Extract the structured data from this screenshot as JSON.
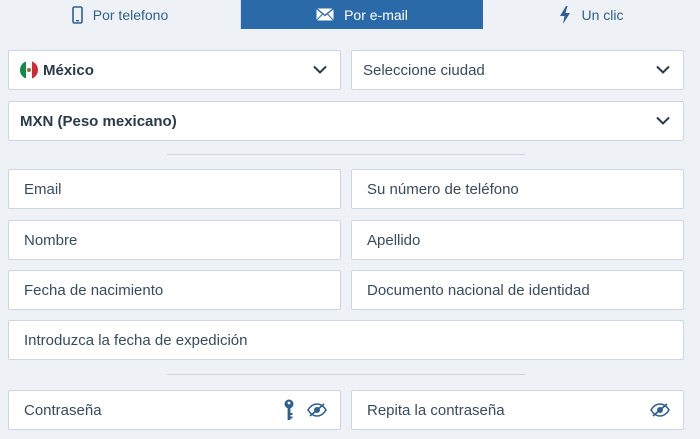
{
  "tabs": [
    {
      "label": "Por telefono",
      "icon": "phone-icon"
    },
    {
      "label": "Por e-mail",
      "icon": "envelope-icon",
      "active": true
    },
    {
      "label": "Un clic",
      "icon": "lightning-icon"
    }
  ],
  "country": {
    "value": "México",
    "icon": "mexico-flag-icon"
  },
  "city": {
    "placeholder": "Seleccione ciudad"
  },
  "currency": {
    "value": "MXN (Peso mexicano)"
  },
  "fields": {
    "email": "Email",
    "phone": "Su número de teléfono",
    "first_name": "Nombre",
    "last_name": "Apellido",
    "birth_date": "Fecha de nacimiento",
    "national_id": "Documento nacional de identidad",
    "issue_date": "Introduzca la fecha de expedición",
    "password": "Contraseña",
    "repeat_password": "Repita la contraseña"
  },
  "colors": {
    "accent": "#2a6aa9",
    "text": "#3a4a5c",
    "border": "#cdd6e0",
    "background": "#eef2f7"
  }
}
